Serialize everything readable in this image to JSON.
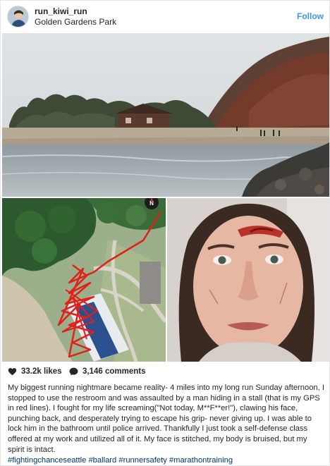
{
  "post": {
    "username": "run_kiwi_run",
    "location": "Golden Gardens Park",
    "follow_label": "Follow"
  },
  "stats": {
    "likes_label": "33.2k likes",
    "comments_label": "3,146 comments"
  },
  "caption": {
    "text": "My biggest running nightmare became reality- 4 miles into my long run Sunday afternoon, I stopped to use the restroom and was assaulted by a man hiding in a stall (that is my GPS in red lines). I fought for my life screaming(\"Not today, M**F**er!\"), clawing his face, punching back, and desperately trying to escape his grip- never giving up. I was able to lock him in the bathroom until police arrived. Thankfully I just took a self-defense class offered at my work and utilized all of it. My face is stitched, my body is bruised, but my spirit is intact.",
    "hashtags": [
      "#fightingchanceseattle",
      "#ballard",
      "#runnersafety",
      "#marathontraining"
    ]
  },
  "icons": {
    "like": "heart-icon",
    "comment": "comment-bubble-icon",
    "compass": "compass-icon"
  },
  "colors": {
    "follow": "#3897f0",
    "hashtag": "#003569",
    "gps_track": "#e0201b"
  }
}
